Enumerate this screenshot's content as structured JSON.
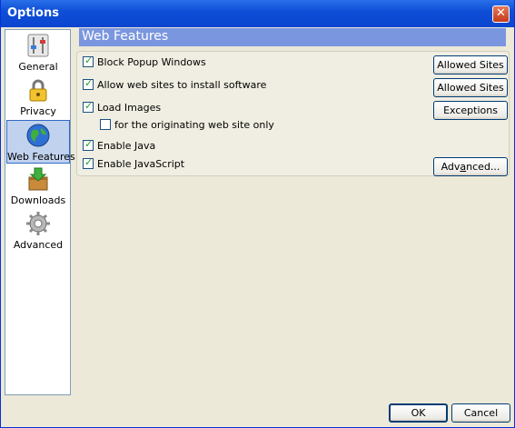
{
  "window": {
    "title": "Options",
    "close_glyph": "✕"
  },
  "sidebar": {
    "items": [
      {
        "label": "General",
        "icon": "sliders-icon"
      },
      {
        "label": "Privacy",
        "icon": "lock-icon"
      },
      {
        "label": "Web Features",
        "icon": "globe-icon"
      },
      {
        "label": "Downloads",
        "icon": "download-box-icon"
      },
      {
        "label": "Advanced",
        "icon": "gear-icon"
      }
    ],
    "selected": "Web Features"
  },
  "panel": {
    "title": "Web Features",
    "options": [
      {
        "label": "Block Popup Windows",
        "checked": true,
        "button": "Allowed Sites"
      },
      {
        "label": "Allow web sites to install software",
        "checked": true,
        "button": "Allowed Sites"
      },
      {
        "label": "Load Images",
        "checked": true,
        "button": "Exceptions"
      },
      {
        "label": "for the originating web site only",
        "checked": false
      },
      {
        "label": "Enable Java",
        "checked": true
      },
      {
        "label": "Enable JavaScript",
        "checked": true,
        "button_parts": [
          "Adv",
          "a",
          "nced..."
        ]
      }
    ]
  },
  "footer": {
    "ok_label": "OK",
    "cancel_label": "Cancel"
  }
}
